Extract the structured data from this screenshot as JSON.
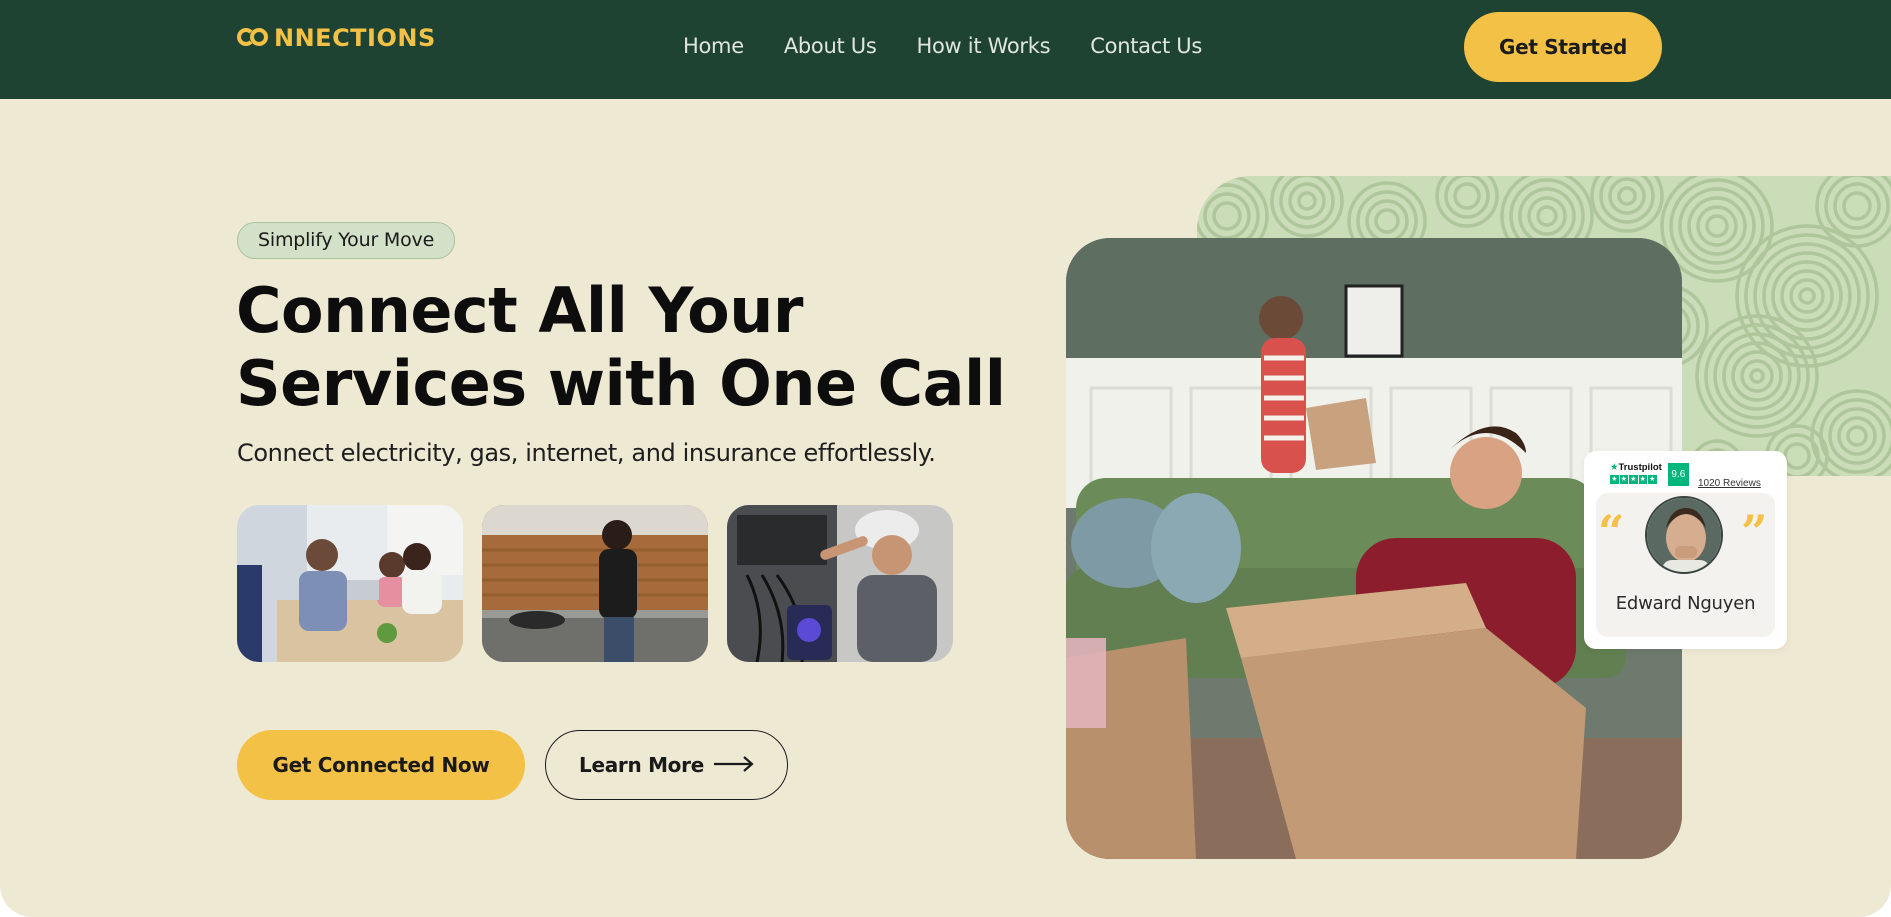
{
  "nav": {
    "logo": "CONNECTIONS",
    "links": [
      "Home",
      "About Us",
      "How it Works",
      "Contact Us"
    ],
    "cta": "Get Started"
  },
  "hero": {
    "badge": "Simplify Your Move",
    "headline_line1": "Connect All Your",
    "headline_line2": "Services with One Call",
    "subtitle": "Connect electricity, gas, internet, and insurance effortlessly.",
    "primary_cta": "Get Connected Now",
    "secondary_cta": "Learn More"
  },
  "thumbnails": [
    {
      "name": "consultation-photo"
    },
    {
      "name": "kitchen-photo"
    },
    {
      "name": "technician-photo"
    }
  ],
  "review": {
    "platform": "Trustpilot",
    "score": "9.6",
    "reviews_count": "1020 Reviews",
    "reviewer": "Edward Nguyen",
    "rating_stars": 5
  },
  "colors": {
    "nav_bg": "#1f4332",
    "hero_bg": "#eee9d3",
    "accent": "#f3c145",
    "badge_bg": "#d2e1c7",
    "pattern_bg": "#cbdcb8",
    "trustpilot_green": "#00b67a"
  }
}
